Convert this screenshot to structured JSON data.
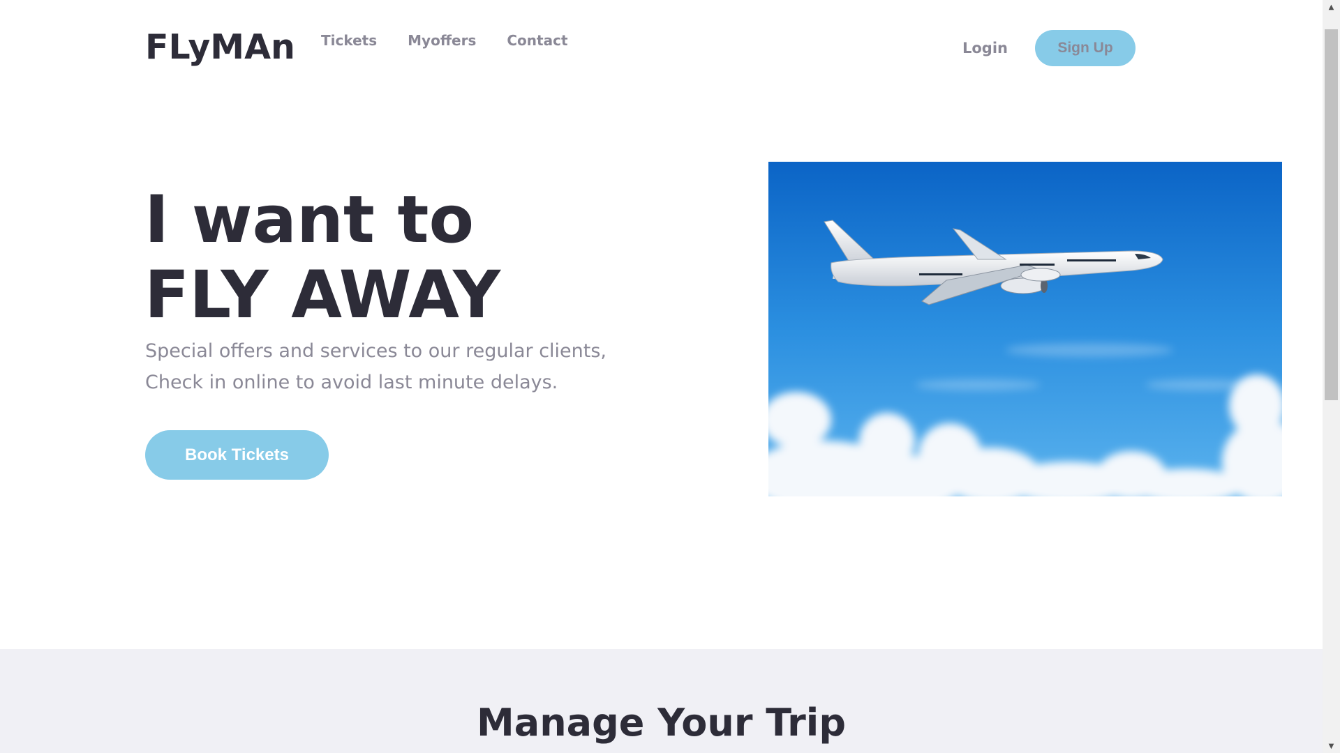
{
  "header": {
    "logo": "FLyMAn",
    "nav": [
      {
        "label": "Tickets"
      },
      {
        "label": "Myoffers"
      },
      {
        "label": "Contact"
      }
    ],
    "login_label": "Login",
    "signup_label": "Sign Up"
  },
  "hero": {
    "title_line1": "I want to",
    "title_line2": "FLY AWAY",
    "subtitle_line1": "Special offers and services to our regular clients,",
    "subtitle_line2": "Check in online to avoid last minute delays.",
    "book_label": "Book Tickets",
    "image_icon": "airplane-in-sky-photo"
  },
  "manage": {
    "title": "Manage Your Trip"
  },
  "scrollbar": {
    "up_icon": "arrow-up-icon",
    "down_icon": "arrow-down-icon"
  },
  "colors": {
    "accent": "#87cbe8",
    "heading": "#2d2c38",
    "muted": "#8a8896",
    "section_bg": "#f0f0f5"
  }
}
